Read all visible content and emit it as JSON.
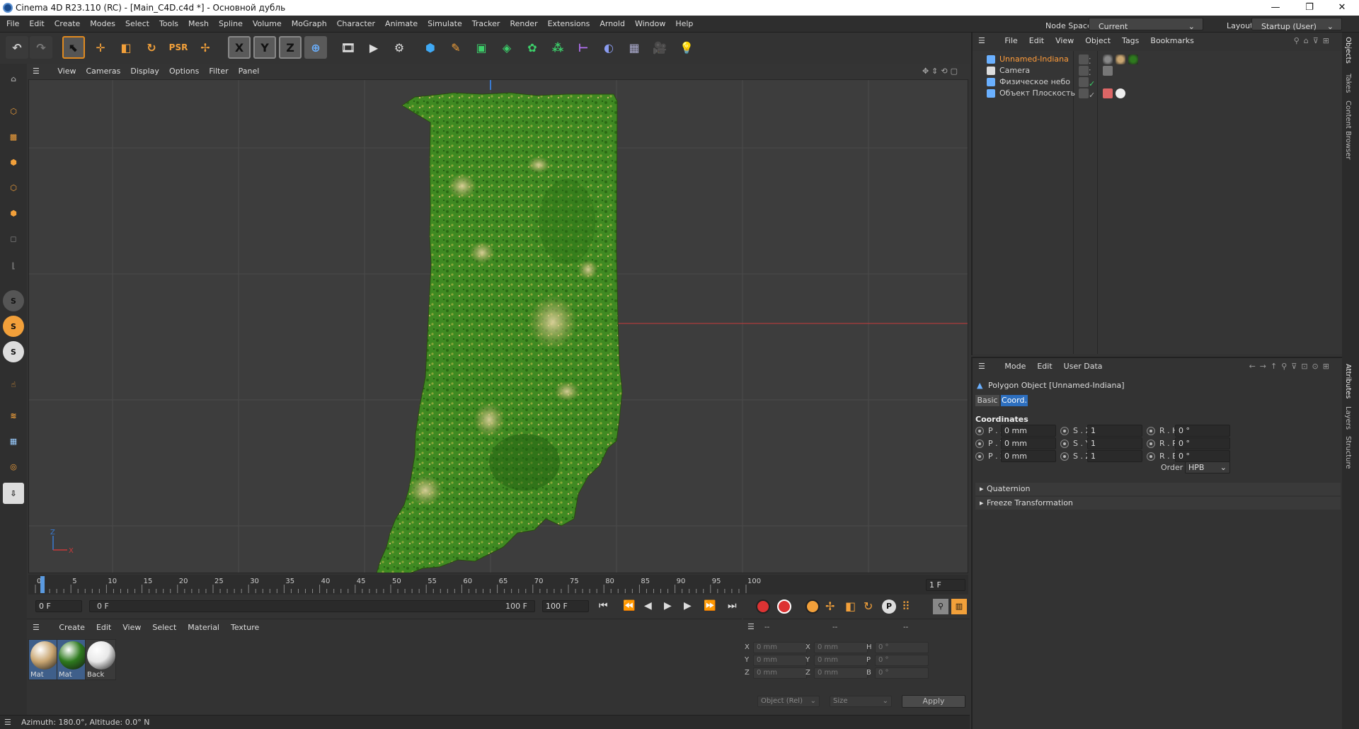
{
  "app": {
    "title": "Cinema 4D R23.110 (RC) - [Main_C4D.c4d *] - Основной дубль",
    "window_controls": [
      "—",
      "❐",
      "✕"
    ]
  },
  "menubar": {
    "items": [
      "File",
      "Edit",
      "Create",
      "Modes",
      "Select",
      "Tools",
      "Mesh",
      "Spline",
      "Volume",
      "MoGraph",
      "Character",
      "Animate",
      "Simulate",
      "Tracker",
      "Render",
      "Extensions",
      "Arnold",
      "Window",
      "Help"
    ],
    "node_space_label": "Node Space:",
    "node_space_value": "Current (Standard/Physical)",
    "layout_label": "Layout:",
    "layout_value": "Startup (User)"
  },
  "toolbar": {
    "axis_x": "X",
    "axis_y": "Y",
    "axis_z": "Z"
  },
  "viewport": {
    "menu": [
      "View",
      "Cameras",
      "Display",
      "Options",
      "Filter",
      "Panel"
    ],
    "axis_z": "Z",
    "axis_x": "X"
  },
  "timeline": {
    "ticks": [
      "0",
      "5",
      "10",
      "15",
      "20",
      "25",
      "30",
      "35",
      "40",
      "45",
      "50",
      "55",
      "60",
      "65",
      "70",
      "75",
      "80",
      "85",
      "90",
      "95",
      "100"
    ],
    "current_frame_field": "1 F",
    "start_field": "0 F",
    "range_start": "0 F",
    "range_end": "100 F",
    "end_field": "100 F"
  },
  "material_manager": {
    "menu": [
      "Create",
      "Edit",
      "View",
      "Select",
      "Material",
      "Texture"
    ],
    "materials": [
      {
        "name": "Mat",
        "color": "#c9a672"
      },
      {
        "name": "Mat",
        "color": "#2e7a1e"
      },
      {
        "name": "Back",
        "color": "#e8e8e8"
      }
    ]
  },
  "coord_manager": {
    "headers": [
      "--",
      "--",
      "--"
    ],
    "rows": [
      {
        "a": "X",
        "av": "0 mm",
        "b": "X",
        "bv": "0 mm",
        "c": "H",
        "cv": "0 °"
      },
      {
        "a": "Y",
        "av": "0 mm",
        "b": "Y",
        "bv": "0 mm",
        "c": "P",
        "cv": "0 °"
      },
      {
        "a": "Z",
        "av": "0 mm",
        "b": "Z",
        "bv": "0 mm",
        "c": "B",
        "cv": "0 °"
      }
    ],
    "mode": "Object (Rel)",
    "size_mode": "Size",
    "apply": "Apply"
  },
  "status": {
    "text": "Azimuth: 180.0°, Altitude: 0.0°  N"
  },
  "object_manager": {
    "menu": [
      "File",
      "Edit",
      "View",
      "Object",
      "Tags",
      "Bookmarks"
    ],
    "objects": [
      {
        "name": "Unnamed-Indiana",
        "color": "#ff9c3a"
      },
      {
        "name": "Camera",
        "color": "#d0d0d0"
      },
      {
        "name": "Физическое небо",
        "color": "#d0d0d0"
      },
      {
        "name": "Объект Плоскость",
        "color": "#d0d0d0"
      }
    ]
  },
  "attribute_manager": {
    "menu": [
      "Mode",
      "Edit",
      "User Data"
    ],
    "object_title": "Polygon Object [Unnamed-Indiana]",
    "tabs": [
      "Basic",
      "Coord."
    ],
    "section_title": "Coordinates",
    "rows": [
      {
        "p": "P . X",
        "pv": "0 mm",
        "s": "S . X",
        "sv": "1",
        "r": "R . H",
        "rv": "0 °"
      },
      {
        "p": "P . Y",
        "pv": "0 mm",
        "s": "S . Y",
        "sv": "1",
        "r": "R . P",
        "rv": "0 °"
      },
      {
        "p": "P . Z",
        "pv": "0 mm",
        "s": "S . Z",
        "sv": "1",
        "r": "R . B",
        "rv": "0 °"
      }
    ],
    "order_label": "Order",
    "order_value": "HPB",
    "collapsed": [
      "Quaternion",
      "Freeze Transformation"
    ]
  },
  "side_tabs": [
    "Objects",
    "Takes",
    "Content Browser",
    "Attributes",
    "Layers",
    "Structure"
  ]
}
